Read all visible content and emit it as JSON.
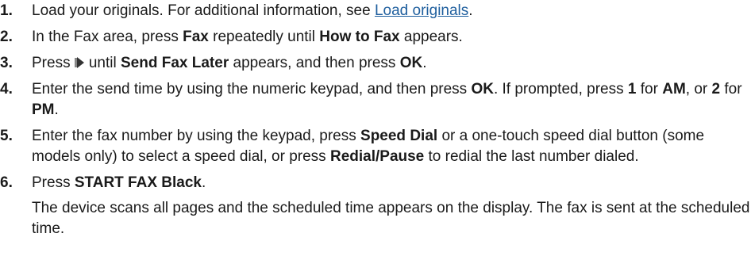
{
  "steps": [
    {
      "number": "1.",
      "before": "Load your originals. For additional information, see ",
      "link": "Load originals",
      "after": "."
    },
    {
      "number": "2.",
      "t1": "In the Fax area, press ",
      "b1": "Fax",
      "t2": " repeatedly until ",
      "b2": "How to Fax",
      "t3": " appears."
    },
    {
      "number": "3.",
      "t1": "Press ",
      "icon": "right-arrow-icon",
      "t2": "until ",
      "b1": "Send Fax Later",
      "t3": " appears, and then press ",
      "b2": "OK",
      "t4": "."
    },
    {
      "number": "4.",
      "t1": "Enter the send time by using the numeric keypad, and then press ",
      "b1": "OK",
      "t2": ". If prompted, press ",
      "b2": "1",
      "t3": " for ",
      "b3": "AM",
      "t4": ", or ",
      "b4": "2",
      "t5": " for ",
      "b5": "PM",
      "t6": "."
    },
    {
      "number": "5.",
      "t1": "Enter the fax number by using the keypad, press ",
      "b1": "Speed Dial",
      "t2": " or a one-touch speed dial button (some models only) to select a speed dial, or press ",
      "b2": "Redial/Pause",
      "t3": " to redial the last number dialed."
    },
    {
      "number": "6.",
      "t1": "Press ",
      "b1": "START FAX Black",
      "t2": ".",
      "follow": "The device scans all pages and the scheduled time appears on the display. The fax is sent at the scheduled time."
    }
  ]
}
